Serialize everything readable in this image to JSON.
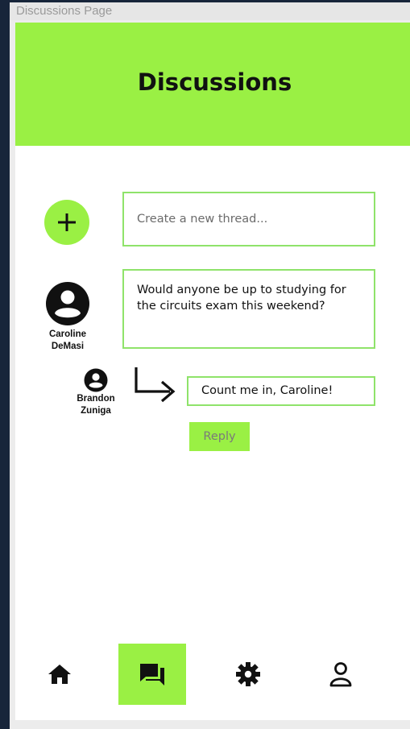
{
  "frame": {
    "label": "Discussions Page"
  },
  "header": {
    "title": "Discussions"
  },
  "composer": {
    "add_icon": "plus-icon",
    "placeholder": "Create a new thread..."
  },
  "thread": {
    "author": {
      "name_line1": "Caroline",
      "name_line2": "DeMasi",
      "icon": "user-avatar-icon"
    },
    "text": "Would anyone be up to studying for the circuits exam this weekend?",
    "reply": {
      "author": {
        "name_line1": "Brandon",
        "name_line2": "Zuniga",
        "icon": "user-avatar-icon"
      },
      "text": "Count me in, Caroline!",
      "arrow_icon": "reply-arrow-icon"
    },
    "reply_button_label": "Reply"
  },
  "bottom_nav": {
    "items": [
      {
        "id": "home",
        "icon": "home-icon",
        "active": false
      },
      {
        "id": "discussions",
        "icon": "forum-icon",
        "active": true
      },
      {
        "id": "settings",
        "icon": "gear-icon",
        "active": false
      },
      {
        "id": "profile",
        "icon": "person-icon",
        "active": false
      }
    ]
  },
  "colors": {
    "accent": "#9af044",
    "field_border": "#8fe36a",
    "background_outer": "#17253a"
  }
}
